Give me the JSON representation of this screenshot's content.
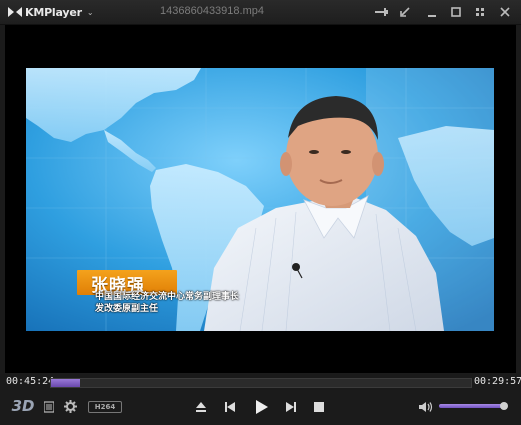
{
  "app": {
    "name": "KMPlayer",
    "filename": "1436860433918.mp4"
  },
  "titlebar": {
    "icons": [
      "pin-icon",
      "minimize-to-corner-icon",
      "minimize-icon",
      "maximize-icon",
      "close-icon"
    ]
  },
  "video": {
    "person_name": "张晓强",
    "person_title_line1": "中国国际经济交流中心常务副理事长",
    "person_title_line2": "发改委原副主任"
  },
  "playback": {
    "elapsed": "00:45:24",
    "remaining": "00:29:57",
    "progress_fraction": 0.07,
    "volume_fraction": 0.9,
    "codec_badge": "H264",
    "mode_3d": "3D"
  },
  "colors": {
    "accent": "#7a58c8",
    "overlay_orange": "#ee8f10",
    "map_blue": "#2f9fe0"
  }
}
